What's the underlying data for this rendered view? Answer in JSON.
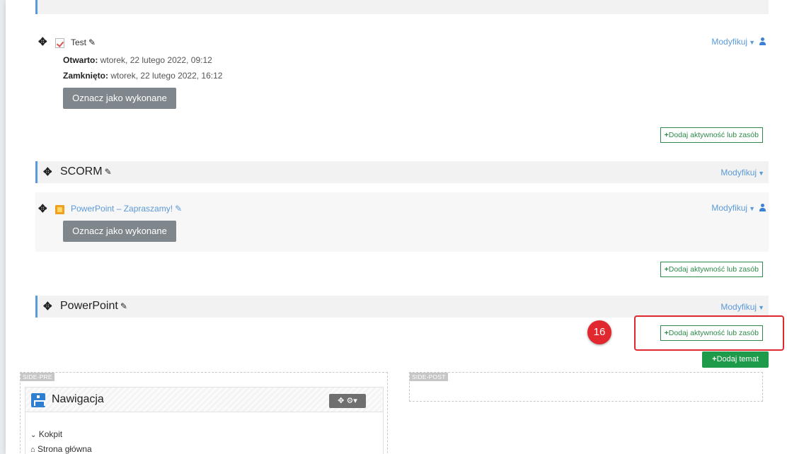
{
  "test_activity": {
    "name": "Test",
    "opened_label": "Otwarto:",
    "opened_value": " wtorek, 22 lutego 2022, 09:12",
    "closed_label": "Zamknięto:",
    "closed_value": " wtorek, 22 lutego 2022, 16:12",
    "mark_done": "Oznacz jako wykonane",
    "modify": "Modyfikuj"
  },
  "add_activity_label": "Dodaj aktywność lub zasób",
  "scorm_section": {
    "title": "SCORM",
    "modify": "Modyfikuj"
  },
  "powerpoint_activity": {
    "name": "PowerPoint – Zapraszamy!",
    "mark_done": "Oznacz jako wykonane",
    "modify": "Modyfikuj"
  },
  "powerpoint_section": {
    "title": "PowerPoint",
    "modify": "Modyfikuj"
  },
  "callout_number": "16",
  "add_topic_label": "Dodaj temat",
  "regions": {
    "side_pre": "SIDE-PRE",
    "side_post": "SIDE-POST"
  },
  "navigation_block": {
    "title": "Nawigacja",
    "items": [
      "Kokpit",
      "Strona główna"
    ]
  },
  "colors": {
    "accent_blue": "#5b9ad8",
    "green": "#1e9a4b",
    "callout_red": "#e0282e"
  },
  "icons": {
    "move": "move-icon",
    "edit": "pencil-icon",
    "user": "user-icon",
    "navigation": "sitemap-icon",
    "gear": "gear-icon"
  }
}
